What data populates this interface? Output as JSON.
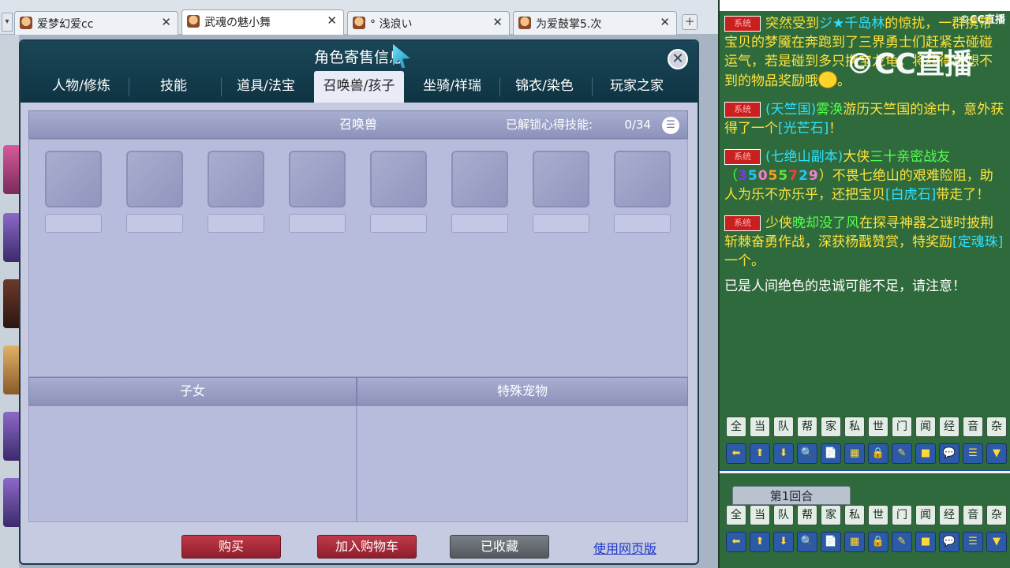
{
  "browser": {
    "tabs": [
      {
        "label": "爱梦幻爱cc",
        "active": false
      },
      {
        "label": "武魂の魅小舞",
        "active": true
      },
      {
        "label": "° 浅浪い",
        "active": false
      },
      {
        "label": "为爱鼓掌5.次",
        "active": false
      }
    ],
    "close_glyph": "✕",
    "new_tab_glyph": "+"
  },
  "dialog": {
    "title": "角色寄售信息",
    "close_glyph": "✕",
    "tabs": [
      "人物/修炼",
      "技能",
      "道具/法宝",
      "召唤兽/孩子",
      "坐骑/祥瑞",
      "锦衣/染色",
      "玩家之家"
    ],
    "active_tab_index": 3,
    "summon_panel": {
      "title": "召唤兽",
      "unlock_label": "已解锁心得技能:",
      "unlock_count": "0/34",
      "slot_count": 8
    },
    "children_panel": {
      "title": "子女"
    },
    "special_pet_panel": {
      "title": "特殊宠物"
    },
    "buttons": {
      "buy": "购买",
      "add_to_cart": "加入购物车",
      "favorited": "已收藏",
      "web_version": "使用网页版"
    }
  },
  "chat": {
    "watermark_small": "©CC直播",
    "watermark_big": "©CC直播",
    "badge": "系统",
    "messages": {
      "m1_a": "突然受到",
      "m1_b": "ジ★千岛林",
      "m1_c": "的惊扰，一群携带宝贝的梦魇在奔跑到了",
      "m1_d": "三界勇士们赶紧去碰碰运气，若是碰到多只携宝龙龟，将获得意想不到的物品奖励哦",
      "m2_a": "(天竺国)",
      "m2_b": "雾涣",
      "m2_c": "游历天竺国的途中，意外获得了一个",
      "m2_d": "[光芒石]",
      "m2_e": "！",
      "m3_a": "(七绝山副本)",
      "m3_b": "大侠",
      "m3_c": "三十亲密战友（",
      "m3_num": [
        "3",
        "5",
        "0",
        "5",
        "5",
        "7",
        "2",
        "9"
      ],
      "m3_d": "）不畏七绝山的艰难险阻，助人为乐不亦乐乎，还把宝贝",
      "m3_e": "[白虎石]",
      "m3_f": "带走了！",
      "m4_a": "少侠",
      "m4_b": "晚却没了风",
      "m4_c": "在探寻神器之谜时披荆斩棘奋勇作战，深获杨戬赞赏，特奖励",
      "m4_d": "[定魂珠]",
      "m4_e": "一个。",
      "m5": "已是人间绝色的忠诚可能不足，请注意！"
    },
    "channels": [
      "全",
      "当",
      "队",
      "帮",
      "家",
      "私",
      "世",
      "门",
      "闻",
      "经",
      "音",
      "杂"
    ],
    "tools": [
      "⬅",
      "⬆",
      "⬇",
      "🔍",
      "📄",
      "▦",
      "🔒",
      "✎",
      "■",
      "💬",
      "☰",
      "▼"
    ],
    "round_label": "第1回合"
  }
}
